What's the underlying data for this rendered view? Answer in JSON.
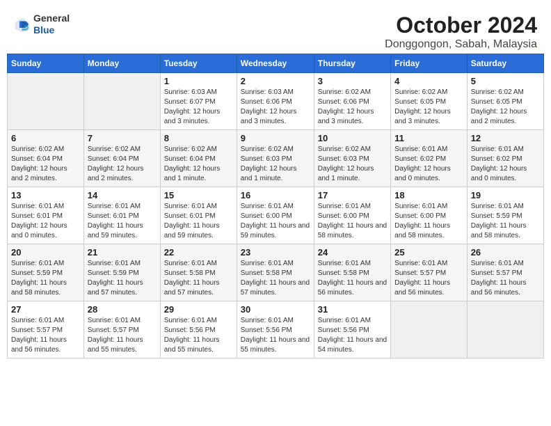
{
  "header": {
    "logo_general": "General",
    "logo_blue": "Blue",
    "month_title": "October 2024",
    "location": "Donggongon, Sabah, Malaysia"
  },
  "calendar": {
    "days_of_week": [
      "Sunday",
      "Monday",
      "Tuesday",
      "Wednesday",
      "Thursday",
      "Friday",
      "Saturday"
    ],
    "weeks": [
      [
        {
          "day": "",
          "info": ""
        },
        {
          "day": "",
          "info": ""
        },
        {
          "day": "1",
          "info": "Sunrise: 6:03 AM\nSunset: 6:07 PM\nDaylight: 12 hours and 3 minutes."
        },
        {
          "day": "2",
          "info": "Sunrise: 6:03 AM\nSunset: 6:06 PM\nDaylight: 12 hours and 3 minutes."
        },
        {
          "day": "3",
          "info": "Sunrise: 6:02 AM\nSunset: 6:06 PM\nDaylight: 12 hours and 3 minutes."
        },
        {
          "day": "4",
          "info": "Sunrise: 6:02 AM\nSunset: 6:05 PM\nDaylight: 12 hours and 3 minutes."
        },
        {
          "day": "5",
          "info": "Sunrise: 6:02 AM\nSunset: 6:05 PM\nDaylight: 12 hours and 2 minutes."
        }
      ],
      [
        {
          "day": "6",
          "info": "Sunrise: 6:02 AM\nSunset: 6:04 PM\nDaylight: 12 hours and 2 minutes."
        },
        {
          "day": "7",
          "info": "Sunrise: 6:02 AM\nSunset: 6:04 PM\nDaylight: 12 hours and 2 minutes."
        },
        {
          "day": "8",
          "info": "Sunrise: 6:02 AM\nSunset: 6:04 PM\nDaylight: 12 hours and 1 minute."
        },
        {
          "day": "9",
          "info": "Sunrise: 6:02 AM\nSunset: 6:03 PM\nDaylight: 12 hours and 1 minute."
        },
        {
          "day": "10",
          "info": "Sunrise: 6:02 AM\nSunset: 6:03 PM\nDaylight: 12 hours and 1 minute."
        },
        {
          "day": "11",
          "info": "Sunrise: 6:01 AM\nSunset: 6:02 PM\nDaylight: 12 hours and 0 minutes."
        },
        {
          "day": "12",
          "info": "Sunrise: 6:01 AM\nSunset: 6:02 PM\nDaylight: 12 hours and 0 minutes."
        }
      ],
      [
        {
          "day": "13",
          "info": "Sunrise: 6:01 AM\nSunset: 6:01 PM\nDaylight: 12 hours and 0 minutes."
        },
        {
          "day": "14",
          "info": "Sunrise: 6:01 AM\nSunset: 6:01 PM\nDaylight: 11 hours and 59 minutes."
        },
        {
          "day": "15",
          "info": "Sunrise: 6:01 AM\nSunset: 6:01 PM\nDaylight: 11 hours and 59 minutes."
        },
        {
          "day": "16",
          "info": "Sunrise: 6:01 AM\nSunset: 6:00 PM\nDaylight: 11 hours and 59 minutes."
        },
        {
          "day": "17",
          "info": "Sunrise: 6:01 AM\nSunset: 6:00 PM\nDaylight: 11 hours and 58 minutes."
        },
        {
          "day": "18",
          "info": "Sunrise: 6:01 AM\nSunset: 6:00 PM\nDaylight: 11 hours and 58 minutes."
        },
        {
          "day": "19",
          "info": "Sunrise: 6:01 AM\nSunset: 5:59 PM\nDaylight: 11 hours and 58 minutes."
        }
      ],
      [
        {
          "day": "20",
          "info": "Sunrise: 6:01 AM\nSunset: 5:59 PM\nDaylight: 11 hours and 58 minutes."
        },
        {
          "day": "21",
          "info": "Sunrise: 6:01 AM\nSunset: 5:59 PM\nDaylight: 11 hours and 57 minutes."
        },
        {
          "day": "22",
          "info": "Sunrise: 6:01 AM\nSunset: 5:58 PM\nDaylight: 11 hours and 57 minutes."
        },
        {
          "day": "23",
          "info": "Sunrise: 6:01 AM\nSunset: 5:58 PM\nDaylight: 11 hours and 57 minutes."
        },
        {
          "day": "24",
          "info": "Sunrise: 6:01 AM\nSunset: 5:58 PM\nDaylight: 11 hours and 56 minutes."
        },
        {
          "day": "25",
          "info": "Sunrise: 6:01 AM\nSunset: 5:57 PM\nDaylight: 11 hours and 56 minutes."
        },
        {
          "day": "26",
          "info": "Sunrise: 6:01 AM\nSunset: 5:57 PM\nDaylight: 11 hours and 56 minutes."
        }
      ],
      [
        {
          "day": "27",
          "info": "Sunrise: 6:01 AM\nSunset: 5:57 PM\nDaylight: 11 hours and 56 minutes."
        },
        {
          "day": "28",
          "info": "Sunrise: 6:01 AM\nSunset: 5:57 PM\nDaylight: 11 hours and 55 minutes."
        },
        {
          "day": "29",
          "info": "Sunrise: 6:01 AM\nSunset: 5:56 PM\nDaylight: 11 hours and 55 minutes."
        },
        {
          "day": "30",
          "info": "Sunrise: 6:01 AM\nSunset: 5:56 PM\nDaylight: 11 hours and 55 minutes."
        },
        {
          "day": "31",
          "info": "Sunrise: 6:01 AM\nSunset: 5:56 PM\nDaylight: 11 hours and 54 minutes."
        },
        {
          "day": "",
          "info": ""
        },
        {
          "day": "",
          "info": ""
        }
      ]
    ]
  }
}
